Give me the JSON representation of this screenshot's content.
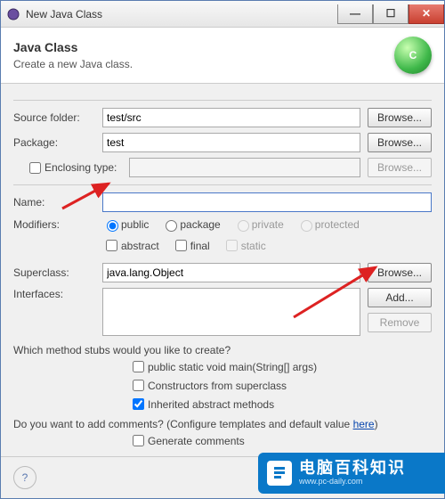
{
  "window": {
    "title": "New Java Class"
  },
  "banner": {
    "title": "Java Class",
    "subtitle": "Create a new Java class.",
    "icon_letter": "C"
  },
  "fields": {
    "source_folder": {
      "label": "Source folder:",
      "value": "test/src",
      "button": "Browse..."
    },
    "package": {
      "label": "Package:",
      "value": "test",
      "button": "Browse..."
    },
    "enclosing": {
      "label": "Enclosing type:",
      "value": "",
      "button": "Browse..."
    },
    "name": {
      "label": "Name:",
      "value": ""
    },
    "modifiers": {
      "label": "Modifiers:",
      "access": {
        "public": "public",
        "package": "package",
        "private": "private",
        "protected": "protected",
        "selected": "public"
      },
      "flags": {
        "abstract": "abstract",
        "final": "final",
        "static": "static"
      }
    },
    "superclass": {
      "label": "Superclass:",
      "value": "java.lang.Object",
      "button": "Browse..."
    },
    "interfaces": {
      "label": "Interfaces:",
      "value": "",
      "add": "Add...",
      "remove": "Remove"
    }
  },
  "stubs": {
    "question": "Which method stubs would you like to create?",
    "main": "public static void main(String[] args)",
    "constructors": "Constructors from superclass",
    "inherited": "Inherited abstract methods",
    "inherited_checked": true
  },
  "comments": {
    "question_pre": "Do you want to add comments? (Configure templates and default value ",
    "link": "here",
    "question_post": ")",
    "generate": "Generate comments"
  },
  "help": {
    "glyph": "?"
  },
  "badge": {
    "main": "电脑百科知识",
    "sub": "www.pc-daily.com"
  }
}
